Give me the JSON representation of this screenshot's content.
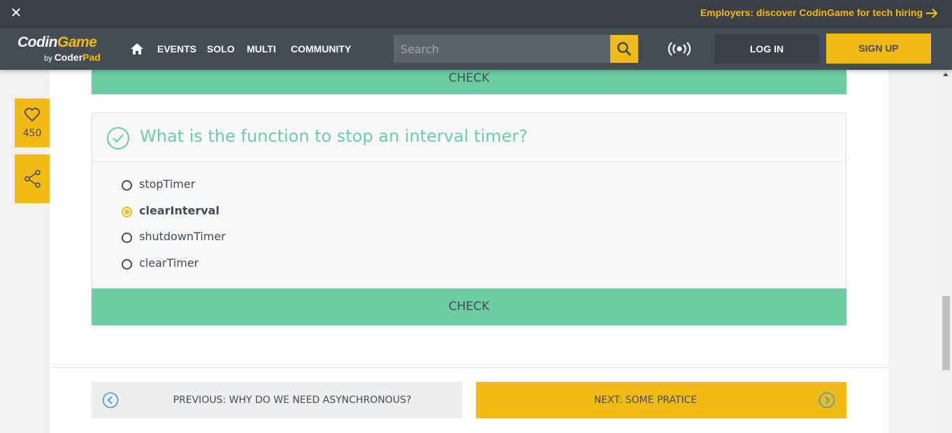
{
  "promo": {
    "text": "Employers: discover CodinGame for tech hiring",
    "close_icon": "close-icon",
    "arrow_icon": "arrow-right-icon"
  },
  "nav": {
    "logo_main_left": "Codin",
    "logo_main_right": "Game",
    "logo_by": "by",
    "logo_coder": "Coder",
    "logo_pad": "Pad",
    "links": [
      "EVENTS",
      "SOLO",
      "MULTI",
      "COMMUNITY"
    ],
    "search_placeholder": "Search",
    "login": "LOG IN",
    "signup": "SIGN UP"
  },
  "sidebar": {
    "likes": "450",
    "like_icon": "heart-icon",
    "share_icon": "share-icon"
  },
  "content": {
    "check_top": "CHECK",
    "quiz": {
      "question": "What is the function to stop an interval timer?",
      "options": [
        {
          "label": "stopTimer",
          "selected": false
        },
        {
          "label": "clearInterval",
          "selected": true
        },
        {
          "label": "shutdownTimer",
          "selected": false
        },
        {
          "label": "clearTimer",
          "selected": false
        }
      ],
      "check_label": "CHECK"
    },
    "previous_label": "PREVIOUS: WHY DO WE NEED ASYNCHRONOUS?",
    "next_label": "NEXT: SOME PRATICE"
  },
  "colors": {
    "accent": "#f2bb13",
    "success": "#6ccda4",
    "nav_bg": "#454c55",
    "promo_bg": "#3a3e47"
  }
}
